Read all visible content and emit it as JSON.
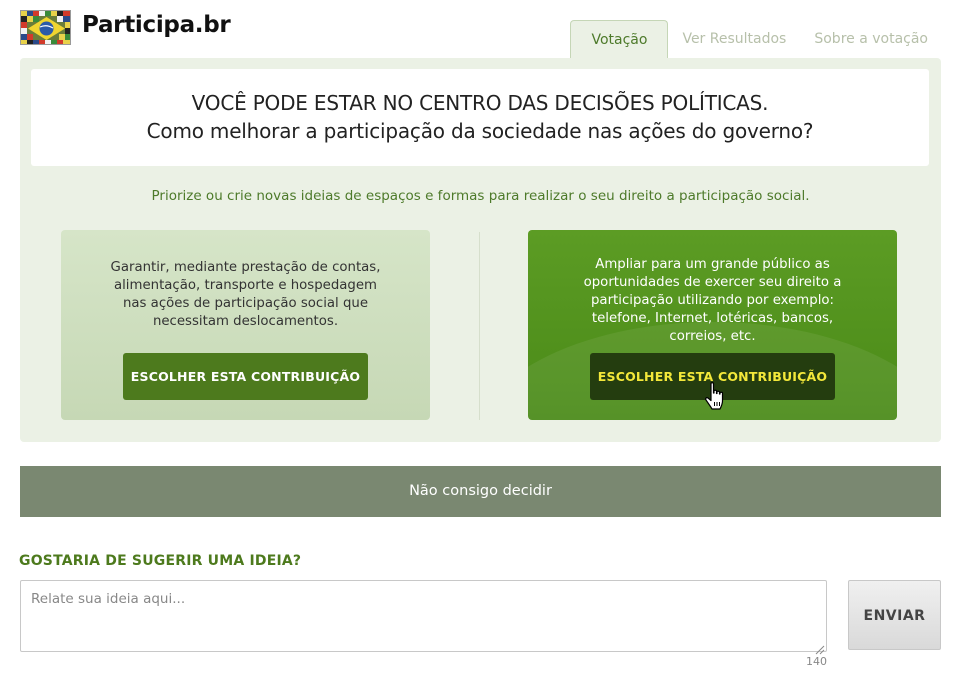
{
  "site": {
    "title": "Participa.br",
    "logo_icon": "brazil-flag-mosaic-icon"
  },
  "tabs": [
    {
      "label": "Votação",
      "active": true
    },
    {
      "label": "Ver Resultados",
      "active": false
    },
    {
      "label": "Sobre a votação",
      "active": false
    }
  ],
  "headline": {
    "line1": "VOCÊ PODE ESTAR NO CENTRO DAS DECISÕES POLÍTICAS.",
    "line2": "Como melhorar a participação da sociedade nas ações do governo?"
  },
  "instruction": "Priorize ou crie novas ideias de espaços e formas para realizar o seu direito a participação social.",
  "options": [
    {
      "text": "Garantir, mediante prestação de contas, alimentação, transporte e hospedagem nas ações de participação social que necessitam deslocamentos.",
      "button_label": "ESCOLHER ESTA CONTRIBUIÇÃO"
    },
    {
      "text": "Ampliar para um grande público as oportunidades de exercer seu direito a participação utilizando por exemplo: telefone, Internet, lotéricas, bancos, correios, etc.",
      "button_label": "ESCOLHER ESTA CONTRIBUIÇÃO"
    }
  ],
  "undecided_label": "Não consigo decidir",
  "suggest": {
    "title": "GOSTARIA DE SUGERIR UMA IDEIA?",
    "placeholder": "Relate sua ideia aqui...",
    "char_count": "140",
    "send_label": "ENVIAR"
  },
  "colors": {
    "brand_green": "#4d7a1d",
    "panel_bg": "#ebf1e5",
    "highlight_green": "#5c9c24",
    "button_yellow_text": "#f3e83a",
    "undecided_bg": "#7a8871"
  }
}
